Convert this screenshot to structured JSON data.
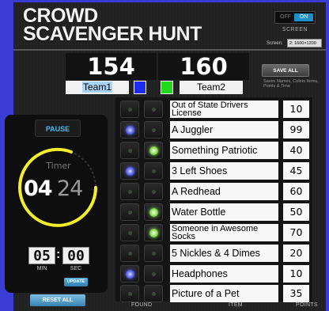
{
  "header": {
    "title_line1": "CROWD",
    "title_line2": "SCAVENGER HUNT",
    "screen_toggle": {
      "off_label": "OFF",
      "on_label": "ON",
      "label": "SCREEN"
    },
    "screen_res_label": "Screen:",
    "screen_res_value": "2: 1600×1200"
  },
  "scores": {
    "team1": {
      "score": "154",
      "name": "Team1",
      "color": "#1d2cf0"
    },
    "team2": {
      "score": "160",
      "name": "Team2",
      "color": "#22d91c"
    }
  },
  "save": {
    "label": "SAVE ALL",
    "note": "Saves Names, Colors Items, Points & Time"
  },
  "timer": {
    "pause_label": "PAUSE",
    "label": "Timer",
    "minutes": "04",
    "seconds": "24",
    "set_minutes": "05",
    "set_seconds": "00",
    "min_label": "MIN",
    "sec_label": "SEC",
    "update_label": "UPDATE",
    "reset_label": "RESET ALL"
  },
  "table": {
    "headers": {
      "found": "FOUND",
      "item": "ITEM",
      "points": "POINTS"
    },
    "rows": [
      {
        "item": "Out of State Drivers License",
        "points": "10",
        "team1_found": false,
        "team2_found": false,
        "two_line": true
      },
      {
        "item": "A Juggler",
        "points": "99",
        "team1_found": true,
        "team2_found": false
      },
      {
        "item": "Something Patriotic",
        "points": "40",
        "team1_found": false,
        "team2_found": true
      },
      {
        "item": "3 Left Shoes",
        "points": "45",
        "team1_found": true,
        "team2_found": false
      },
      {
        "item": "A Redhead",
        "points": "60",
        "team1_found": false,
        "team2_found": false
      },
      {
        "item": "Water Bottle",
        "points": "50",
        "team1_found": false,
        "team2_found": true
      },
      {
        "item": "Someone in Awesome Socks",
        "points": "70",
        "team1_found": false,
        "team2_found": true,
        "two_line": true
      },
      {
        "item": "5 Nickles & 4 Dimes",
        "points": "20",
        "team1_found": false,
        "team2_found": false
      },
      {
        "item": "Headphones",
        "points": "10",
        "team1_found": true,
        "team2_found": false
      },
      {
        "item": "Picture of a Pet",
        "points": "35",
        "team1_found": false,
        "team2_found": false
      }
    ]
  }
}
